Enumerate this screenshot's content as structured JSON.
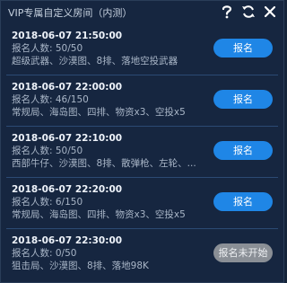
{
  "window": {
    "title": "VIP专属自定义房间（内测）",
    "icons": [
      "help-icon",
      "refresh-icon",
      "close-icon"
    ]
  },
  "rooms": [
    {
      "time": "2018-06-07 21:50:00",
      "count": "报名人数: 50/50",
      "desc": "超级武器、沙漠图、8排、落地空投武器",
      "button": "报名",
      "enabled": true
    },
    {
      "time": "2018-06-07 22:00:00",
      "count": "报名人数: 46/150",
      "desc": "常规局、海岛图、四排、物资x3、空投x5",
      "button": "报名",
      "enabled": true
    },
    {
      "time": "2018-06-07 22:10:00",
      "count": "报名人数: 50/50",
      "desc": "西部牛仔、沙漠图、8排、散弹枪、左轮、...",
      "button": "报名",
      "enabled": true
    },
    {
      "time": "2018-06-07 22:20:00",
      "count": "报名人数: 6/150",
      "desc": "常规局、海岛图、四排、物资x3、空投x5",
      "button": "报名",
      "enabled": true
    },
    {
      "time": "2018-06-07 22:30:00",
      "count": "报名人数: 0/50",
      "desc": "狙击局、沙漠图、8排、落地98K",
      "button": "报名未开始",
      "enabled": false
    }
  ],
  "colors": {
    "accent": "#1f86e6",
    "disabled": "#8a8f96",
    "background": "#162640",
    "divider": "#2b4a73"
  }
}
